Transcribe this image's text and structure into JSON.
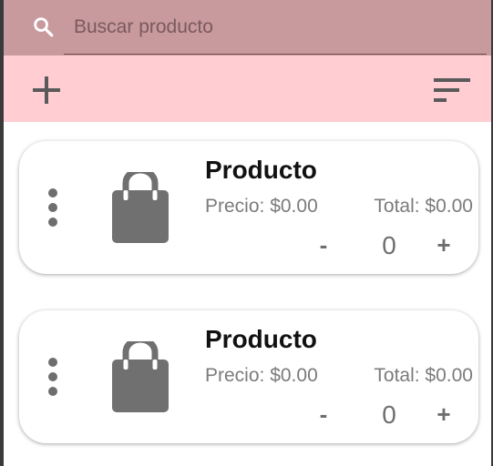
{
  "search": {
    "placeholder": "Buscar producto",
    "icon": "search-icon"
  },
  "toolbar": {
    "add_icon": "plus-icon",
    "sort_icon": "sort-icon"
  },
  "colors": {
    "search_bar": "#c89a9e",
    "toolbar": "#ffcdd2",
    "icon_gray": "#6e6e6e",
    "text_gray": "#7b7b7b"
  },
  "products": [
    {
      "name": "Producto",
      "price_label": "Precio: $0.00",
      "total_label": "Total: $0.00",
      "minus_label": "-",
      "quantity": "0",
      "plus_label": "+",
      "icon": "shopping-bag-icon"
    },
    {
      "name": "Producto",
      "price_label": "Precio: $0.00",
      "total_label": "Total: $0.00",
      "minus_label": "-",
      "quantity": "0",
      "plus_label": "+",
      "icon": "shopping-bag-icon"
    }
  ]
}
